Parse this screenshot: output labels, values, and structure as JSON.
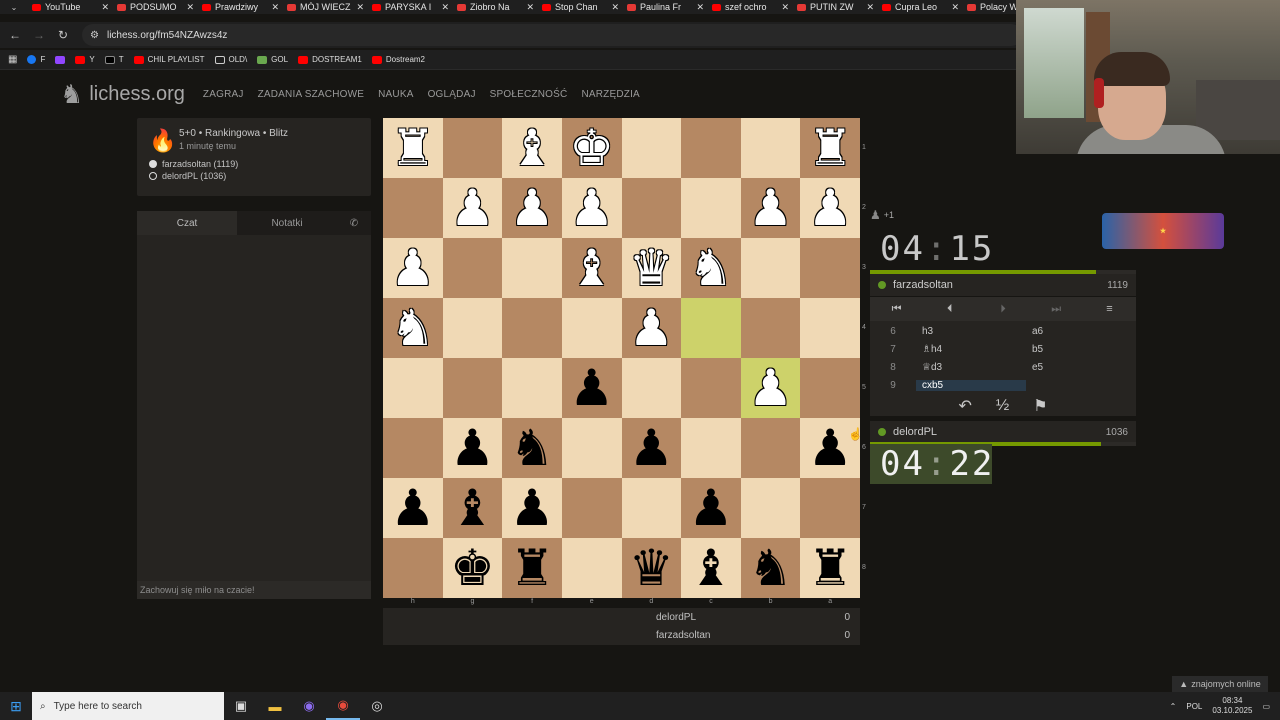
{
  "browser": {
    "tabs": [
      "YouTube",
      "PODSUMO",
      "Prawdziwy",
      "MÓJ WIECZ",
      "PARYSKA I",
      "Ziobro Na",
      "Stop Chan",
      "Paulina Fr",
      "szef ochro",
      "PUTIN ZW",
      "Cupra Leo",
      "Polacy W"
    ],
    "url": "lichess.org/fm54NZAwzs4z",
    "bookmarks": [
      "F",
      "Y",
      "T",
      "CHIL PLAYLIST",
      "OLD\\",
      "GOL",
      "DOSTREAM1",
      "Dostream2"
    ]
  },
  "lichess": {
    "logo": "lichess.org",
    "nav": [
      "ZAGRAJ",
      "ZADANIA SZACHOWE",
      "NAUKA",
      "OGLĄDAJ",
      "SPOŁECZNOŚĆ",
      "NARZĘDZIA"
    ]
  },
  "game": {
    "title": "5+0 • Rankingowa • Blitz",
    "time_ago": "1 minutę temu",
    "white_player": "farzadsoltan (1119)",
    "black_player": "delordPL (1036)"
  },
  "chat": {
    "tab_chat": "Czat",
    "tab_notes": "Notatki",
    "placeholder": "Zachowuj się miło na czacie!"
  },
  "board": {
    "orientation": "black",
    "squares": [
      [
        "R",
        "",
        "B",
        "K",
        "",
        "",
        "",
        "R"
      ],
      [
        "",
        "P",
        "P",
        "P",
        "",
        "",
        "P",
        "P"
      ],
      [
        "P",
        "",
        "",
        "B",
        "Q",
        "N",
        "",
        ""
      ],
      [
        "N",
        "",
        "",
        "",
        "P",
        "",
        "",
        ""
      ],
      [
        "",
        "",
        "",
        "p",
        "",
        "",
        "P",
        ""
      ],
      [
        "",
        "p",
        "n",
        "",
        "p",
        "",
        "",
        "p"
      ],
      [
        "p",
        "b",
        "p",
        "",
        "",
        "p",
        "",
        ""
      ],
      [
        "",
        "k",
        "r",
        "",
        "q",
        "b",
        "n",
        "r"
      ]
    ],
    "highlights": [
      [
        3,
        5
      ],
      [
        4,
        6
      ]
    ],
    "rank_labels": [
      "1",
      "2",
      "3",
      "4",
      "5",
      "6",
      "7",
      "8"
    ],
    "file_labels": [
      "h",
      "g",
      "f",
      "e",
      "d",
      "c",
      "b",
      "a"
    ]
  },
  "score": [
    {
      "name": "delordPL",
      "value": "0"
    },
    {
      "name": "farzadsoltan",
      "value": "0"
    }
  ],
  "right": {
    "spectators": "+1",
    "top_clock": {
      "min": "04",
      "sec": "15",
      "remaining_fraction": 0.85
    },
    "bottom_clock": {
      "min": "04",
      "sec": "22",
      "remaining_fraction": 0.87
    },
    "top_player": {
      "name": "farzadsoltan",
      "rating": "1119"
    },
    "bottom_player": {
      "name": "delordPL",
      "rating": "1036"
    },
    "moves": [
      {
        "n": "6",
        "w": "h3",
        "b": "a6"
      },
      {
        "n": "7",
        "w": "♗h4",
        "b": "b5"
      },
      {
        "n": "8",
        "w": "♕d3",
        "b": "e5"
      },
      {
        "n": "9",
        "w": "cxb5",
        "b": ""
      }
    ],
    "current_move_index": 3,
    "draw_label": "½"
  },
  "footer": {
    "friends_online": "znajomych online",
    "search_placeholder": "Type here to search",
    "lang": "POL",
    "time": "08:34",
    "date": "03.10.2025"
  }
}
